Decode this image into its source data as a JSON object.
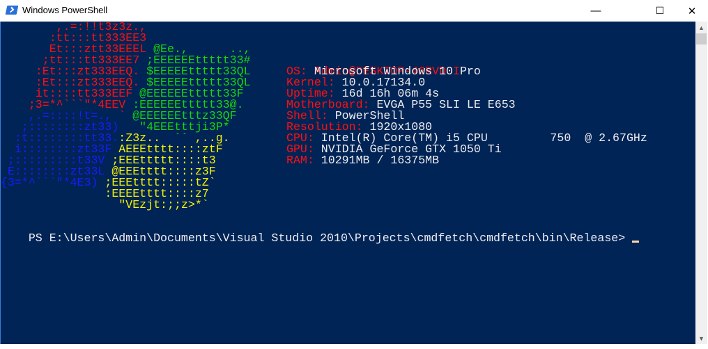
{
  "window": {
    "title": "Windows PowerShell",
    "minimize": "—",
    "maximize": "☐",
    "close": "✕"
  },
  "colors": {
    "bg": "#012456",
    "red": "#ff1010",
    "green": "#16d60c",
    "yellow": "#f4f400",
    "blue": "#1a1aff",
    "text": "#eeedf0"
  },
  "art": [
    [
      {
        "t": "        ,.=:!!t3z3z.,",
        "c": "red"
      }
    ],
    [
      {
        "t": "       :tt:::tt333EE3",
        "c": "red"
      }
    ],
    [
      {
        "t": "       Et:::ztt33EEEL",
        "c": "red"
      },
      {
        "t": " @Ee.,      ..,",
        "c": "green"
      }
    ],
    [
      {
        "t": "      ;tt:::tt333EE7",
        "c": "red"
      },
      {
        "t": " ;EEEEEEttttt33#",
        "c": "green"
      }
    ],
    [
      {
        "t": "     :Et:::zt333EEQ.",
        "c": "red"
      },
      {
        "t": " $EEEEEttttt33QL",
        "c": "green"
      }
    ],
    [
      {
        "t": "     :Et:::zt333EEQ.",
        "c": "red"
      },
      {
        "t": " $EEEEEttttt33QL",
        "c": "green"
      }
    ],
    [
      {
        "t": "     it::::tt333EEF",
        "c": "red"
      },
      {
        "t": " @EEEEEEttttt33F",
        "c": "green"
      }
    ],
    [
      {
        "t": "    ;3=*^```\"*4EEV",
        "c": "red"
      },
      {
        "t": " :EEEEEEttttt33@.",
        "c": "green"
      }
    ],
    [
      {
        "t": "    ,.=::::!t=., ",
        "c": "blue"
      },
      {
        "t": "`",
        "c": "red"
      },
      {
        "t": " @EEEEEEtttz33QF",
        "c": "green"
      }
    ],
    [
      {
        "t": "   ;::::::::zt33)",
        "c": "blue"
      },
      {
        "t": "   \"4EEEtttji3P*",
        "c": "green"
      }
    ],
    [
      {
        "t": "  :t::::::::tt33.",
        "c": "blue"
      },
      {
        "t": ":Z3z..",
        "c": "yellow"
      },
      {
        "t": "  ``",
        "c": "green"
      },
      {
        "t": " ,..g.",
        "c": "yellow"
      }
    ],
    [
      {
        "t": "  i::::::::zt33F",
        "c": "blue"
      },
      {
        "t": " AEEEtttt::::ztF",
        "c": "yellow"
      }
    ],
    [
      {
        "t": " ;:::::::::t33V",
        "c": "blue"
      },
      {
        "t": " ;EEEttttt::::t3",
        "c": "yellow"
      }
    ],
    [
      {
        "t": " E::::::::zt33L",
        "c": "blue"
      },
      {
        "t": " @EEEtttt::::z3F",
        "c": "yellow"
      }
    ],
    [
      {
        "t": "{3=*^```\"*4E3)",
        "c": "blue"
      },
      {
        "t": " ;EEEtttt:::::tZ`",
        "c": "yellow"
      }
    ],
    [
      {
        "t": "               :EEEEtttt::::z7",
        "c": "yellow"
      }
    ],
    [
      {
        "t": "                 \"VEzjt:;;z>*`",
        "c": "yellow"
      }
    ]
  ],
  "info": {
    "user_host": "Admin@DESKTOP-46RVDOI",
    "fields": [
      {
        "label": "OS:",
        "value": " Microsoft Windows 10 Pro"
      },
      {
        "label": "Kernel:",
        "value": " 10.0.17134.0"
      },
      {
        "label": "Uptime:",
        "value": " 16d 16h 06m 4s"
      },
      {
        "label": "Motherboard:",
        "value": " EVGA P55 SLI LE E653"
      },
      {
        "label": "Shell:",
        "value": " PowerShell"
      },
      {
        "label": "Resolution:",
        "value": " 1920x1080"
      },
      {
        "label": "CPU:",
        "value": " Intel(R) Core(TM) i5 CPU         750  @ 2.67GHz"
      },
      {
        "label": "GPU:",
        "value": " NVIDIA GeForce GTX 1050 Ti"
      },
      {
        "label": "RAM:",
        "value": " 10291MB / 16375MB"
      }
    ]
  },
  "prompt": "PS E:\\Users\\Admin\\Documents\\Visual Studio 2010\\Projects\\cmdfetch\\cmdfetch\\bin\\Release> "
}
